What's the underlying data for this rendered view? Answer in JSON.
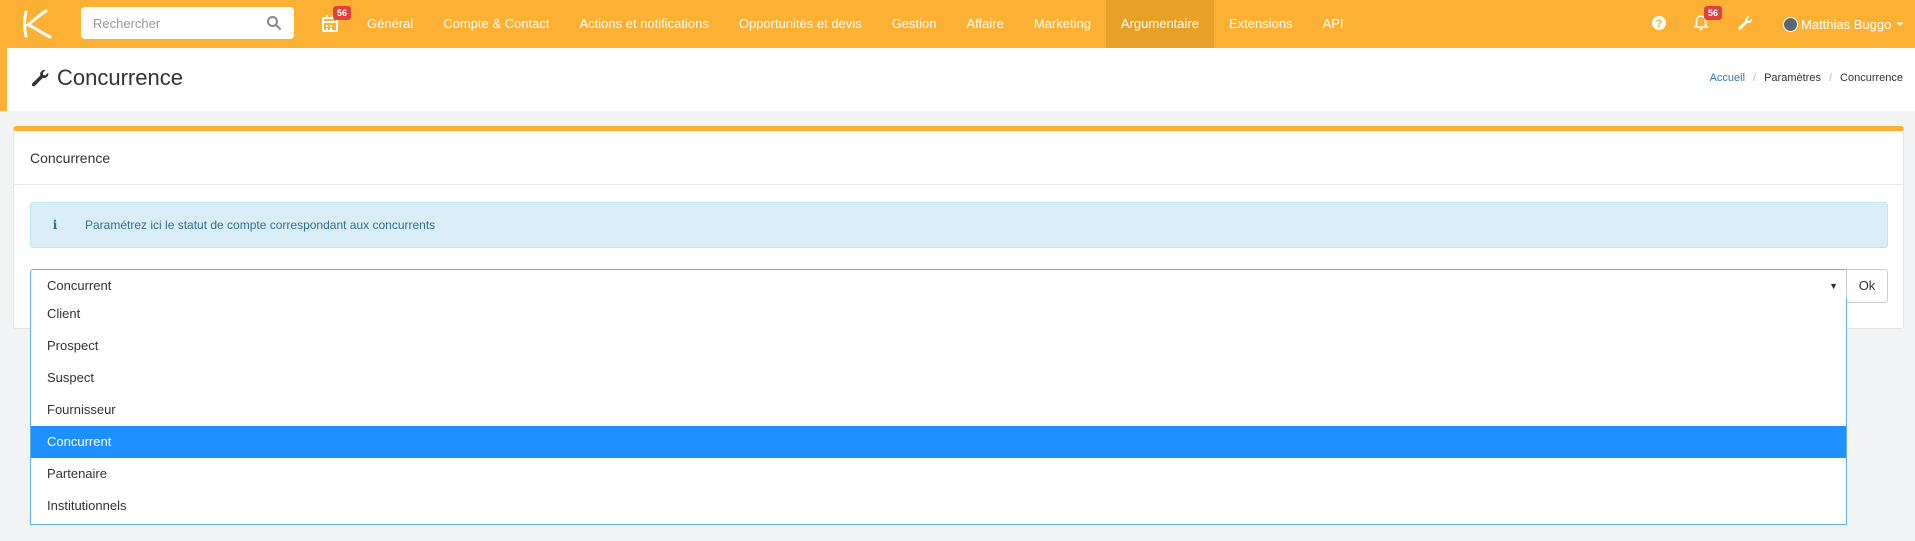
{
  "navbar": {
    "search_placeholder": "Rechercher",
    "calendar_badge": "56",
    "menu": [
      {
        "label": "Général"
      },
      {
        "label": "Compte & Contact"
      },
      {
        "label": "Actions et notifications"
      },
      {
        "label": "Opportunités et devis"
      },
      {
        "label": "Gestion"
      },
      {
        "label": "Affaire"
      },
      {
        "label": "Marketing"
      },
      {
        "label": "Argumentaire"
      },
      {
        "label": "Extensions"
      },
      {
        "label": "API"
      }
    ],
    "active_menu": "Argumentaire",
    "notification_badge": "56",
    "user_name": "Matthias Buggo"
  },
  "page": {
    "title": "Concurrence",
    "breadcrumb": [
      "Accueil",
      "Paramètres",
      "Concurrence"
    ]
  },
  "panel": {
    "heading": "Concurrence",
    "info_text": "Paramétrez ici le statut de compte correspondant aux concurrents",
    "select_value": "Concurrent",
    "ok_label": "Ok",
    "options": [
      "Client",
      "Prospect",
      "Suspect",
      "Fournisseur",
      "Concurrent",
      "Partenaire",
      "Institutionnels"
    ],
    "selected_option": "Concurrent"
  },
  "colors": {
    "brand": "#fcb034",
    "brand_dark": "#e8a128",
    "badge": "#e0413f",
    "info_bg": "#d9edf7",
    "info_text": "#31708f",
    "selected": "#1e90ff",
    "link": "#337ab7"
  }
}
